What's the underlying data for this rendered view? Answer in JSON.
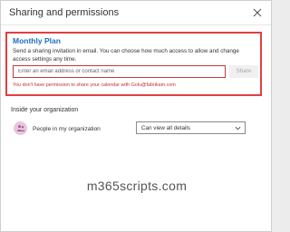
{
  "dialog": {
    "title": "Sharing and permissions"
  },
  "share_section": {
    "calendar_name": "Monthly Plan",
    "description": "Send a sharing invitation in email. You can choose how much access to allow and change access settings any time.",
    "email_input": {
      "value": "",
      "placeholder": "Enter an email address or contact name"
    },
    "share_button_label": "Share",
    "error_message": "You don't have permission to share your calendar with Golu@fabrikam.com",
    "highlight_color": "#e04040",
    "error_color": "#c53030"
  },
  "organization_section": {
    "heading": "Inside your organization",
    "member_label": "People in my organization",
    "permission": {
      "selected": "Can view all details"
    },
    "avatar_icon": "people-icon"
  },
  "watermark": "m365scripts.com",
  "colors": {
    "accent": "#1f6fbf",
    "avatar_bg": "#e5c7dc",
    "avatar_fg": "#b05592"
  }
}
